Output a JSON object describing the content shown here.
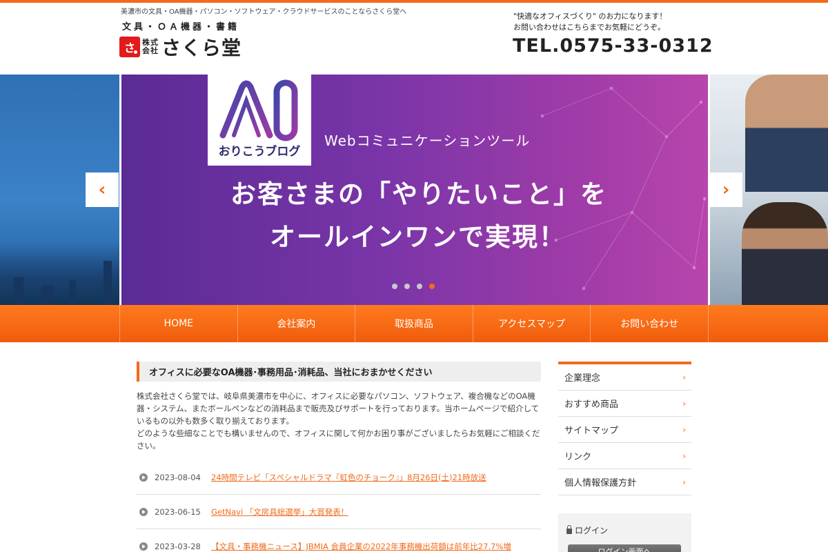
{
  "header": {
    "tagline": "美濃市の文具・OA機器・パソコン・ソフトウェア・クラウドサービスのことならさくら堂へ",
    "logo_sub": "文具・ＯＡ機器・書籍",
    "logo_company_line1": "株式",
    "logo_company_line2": "会社",
    "logo_name": "さくら堂",
    "message_line1": "\"快適なオフィスづくり\" のお力になります！",
    "message_line2": "お問い合わせはこちらまでお気軽にどうぞ。",
    "tel": "TEL.0575-33-0312"
  },
  "slider": {
    "badge_label": "おりこうブログ",
    "subtitle": "Webコミュニケーションツール",
    "headline_line1": "お客さまの「やりたいこと」を",
    "headline_line2": "オールインワンで実現！",
    "dot_count": 4,
    "active_dot": 4,
    "prev_icon": "chevron-left-icon",
    "next_icon": "chevron-right-icon"
  },
  "nav": {
    "items": [
      {
        "label": "HOME"
      },
      {
        "label": "会社案内"
      },
      {
        "label": "取扱商品"
      },
      {
        "label": "アクセスマップ"
      },
      {
        "label": "お問い合わせ"
      }
    ]
  },
  "main": {
    "section_title": "オフィスに必要なOA機器･事務用品･消耗品、当社におまかせください",
    "intro_p1": "株式会社さくら堂では、岐阜県美濃市を中心に、オフィスに必要なパソコン、ソフトウェア、複合機などのOA機器・システム、またボールペンなどの消耗品まで販売及びサポートを行っております。当ホームページで紹介しているもの以外も数多く取り揃えております。",
    "intro_p2": "どのような些細なことでも構いませんので、オフィスに関して何かお困り事がございましたらお気軽にご相談ください。",
    "news": [
      {
        "date": "2023-08-04",
        "title": "24時間テレビ「スペシャルドラマ『虹色のチョーク』」8月26日(土)21時放送"
      },
      {
        "date": "2023-06-15",
        "title": "GetNavi 「文房具総選挙」大賞発表！"
      },
      {
        "date": "2023-03-28",
        "title": "【文具・事務機ニュース】JBMIA 会員企業の2022年事務機出荷額は前年比27.7%増"
      }
    ]
  },
  "sidebar": {
    "items": [
      {
        "label": "企業理念"
      },
      {
        "label": "おすすめ商品"
      },
      {
        "label": "サイトマップ"
      },
      {
        "label": "リンク"
      },
      {
        "label": "個人情報保護方針"
      }
    ],
    "login_title": "ログイン",
    "login_button": "ログイン画面へ"
  },
  "colors": {
    "accent": "#f26a1b",
    "slide_left": "#5a2b96",
    "slide_right": "#b845ad"
  }
}
